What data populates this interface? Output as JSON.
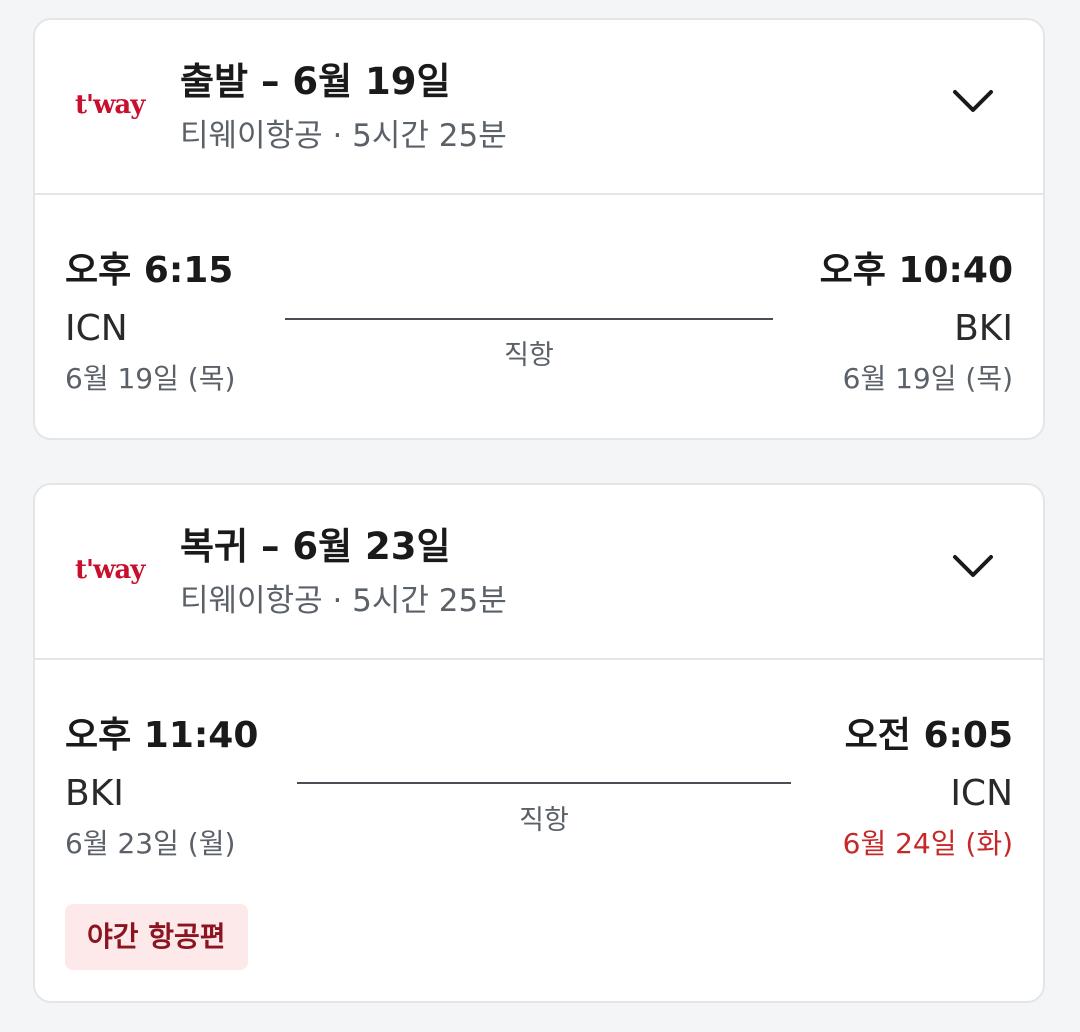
{
  "colors": {
    "brand_red": "#c8102e",
    "next_day_date": "#c62828",
    "badge_bg": "#fde8ea",
    "badge_text": "#8a1420"
  },
  "outbound": {
    "airline_logo_text": "t'way",
    "title": "출발 – 6월 19일",
    "subtitle": "티웨이항공 · 5시간 25분",
    "expand_icon": "chevron-down-icon",
    "departure": {
      "time": "오후 6:15",
      "code": "ICN",
      "date": "6월 19일 (목)"
    },
    "route_label": "직항",
    "arrival": {
      "time": "오후 10:40",
      "code": "BKI",
      "date": "6월 19일 (목)"
    }
  },
  "return": {
    "airline_logo_text": "t'way",
    "title": "복귀 – 6월 23일",
    "subtitle": "티웨이항공 · 5시간 25분",
    "expand_icon": "chevron-down-icon",
    "departure": {
      "time": "오후 11:40",
      "code": "BKI",
      "date": "6월 23일 (월)"
    },
    "route_label": "직항",
    "arrival": {
      "time": "오전 6:05",
      "code": "ICN",
      "date": "6월 24일 (화)"
    },
    "badge": "야간 항공편"
  }
}
